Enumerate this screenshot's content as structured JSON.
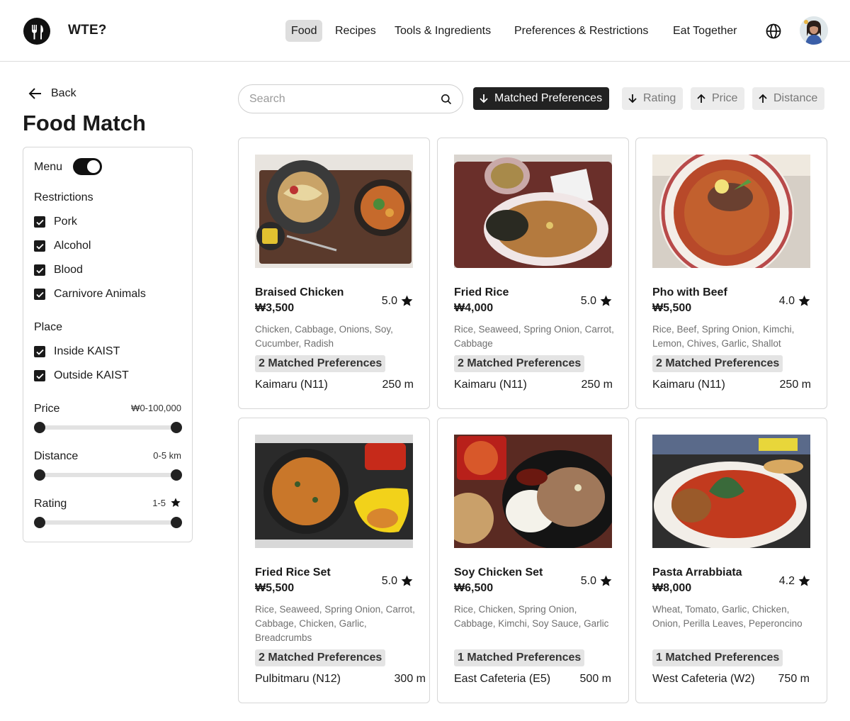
{
  "app": {
    "brand": "WTE?",
    "nav": [
      {
        "label": "Food",
        "active": true
      },
      {
        "label": "Recipes",
        "active": false
      },
      {
        "label": "Tools & Ingredients",
        "active": false
      },
      {
        "label": "Preferences & Restrictions",
        "active": false
      },
      {
        "label": "Eat Together",
        "active": false
      }
    ],
    "icons": {
      "logo": "fork-knife-logo-icon",
      "language": "globe-icon",
      "avatar": "user-avatar"
    }
  },
  "page": {
    "back_label": "Back",
    "title": "Food Match"
  },
  "filters": {
    "menu_label": "Menu",
    "menu_toggle_on": true,
    "restrictions_label": "Restrictions",
    "restrictions": [
      "Pork",
      "Alcohol",
      "Blood",
      "Carnivore Animals"
    ],
    "place_label": "Place",
    "places": [
      "Inside KAIST",
      "Outside KAIST"
    ],
    "price_label": "Price",
    "price_range": "₩0-100,000",
    "distance_label": "Distance",
    "distance_range": "0-5 km",
    "rating_label": "Rating",
    "rating_range": "1-5"
  },
  "search": {
    "placeholder": "Search",
    "value": ""
  },
  "sort": [
    {
      "label": "Matched Preferences",
      "direction": "down",
      "active": true
    },
    {
      "label": "Rating",
      "direction": "down",
      "active": false
    },
    {
      "label": "Price",
      "direction": "up",
      "active": false
    },
    {
      "label": "Distance",
      "direction": "up",
      "active": false
    }
  ],
  "cards": [
    {
      "name": "Braised Chicken",
      "price": "₩3,500",
      "rating": "5.0",
      "ingredients": "Chicken, Cabbage, Onions, Soy, Cucumber, Radish",
      "matched": "2 Matched Preferences",
      "place": "Kaimaru (N11)",
      "distance": "250 m"
    },
    {
      "name": "Fried Rice",
      "price": "₩4,000",
      "rating": "5.0",
      "ingredients": "Rice, Seaweed, Spring Onion, Carrot, Cabbage",
      "matched": "2 Matched Preferences",
      "place": "Kaimaru (N11)",
      "distance": "250 m"
    },
    {
      "name": "Pho with Beef",
      "price": "₩5,500",
      "rating": "4.0",
      "ingredients": "Rice, Beef, Spring Onion, Kimchi, Lemon, Chives, Garlic, Shallot",
      "matched": "2 Matched Preferences",
      "place": "Kaimaru (N11)",
      "distance": "250 m"
    },
    {
      "name": "Fried Rice Set",
      "price": "₩5,500",
      "rating": "5.0",
      "ingredients": "Rice, Seaweed, Spring Onion, Carrot, Cabbage, Chicken, Garlic, Breadcrumbs",
      "matched": "2 Matched Preferences",
      "place": "Pulbitmaru (N12)",
      "distance": "300 m"
    },
    {
      "name": "Soy Chicken Set",
      "price": "₩6,500",
      "rating": "5.0",
      "ingredients": "Rice, Chicken, Spring Onion, Cabbage, Kimchi, Soy Sauce, Garlic",
      "matched": "1 Matched Preferences",
      "place": "East Cafeteria (E5)",
      "distance": "500 m"
    },
    {
      "name": "Pasta Arrabbiata",
      "price": "₩8,000",
      "rating": "4.2",
      "ingredients": "Wheat, Tomato, Garlic, Chicken, Onion, Perilla Leaves, Peperoncino",
      "matched": "1 Matched Preferences",
      "place": "West Cafeteria (W2)",
      "distance": "750 m"
    }
  ]
}
